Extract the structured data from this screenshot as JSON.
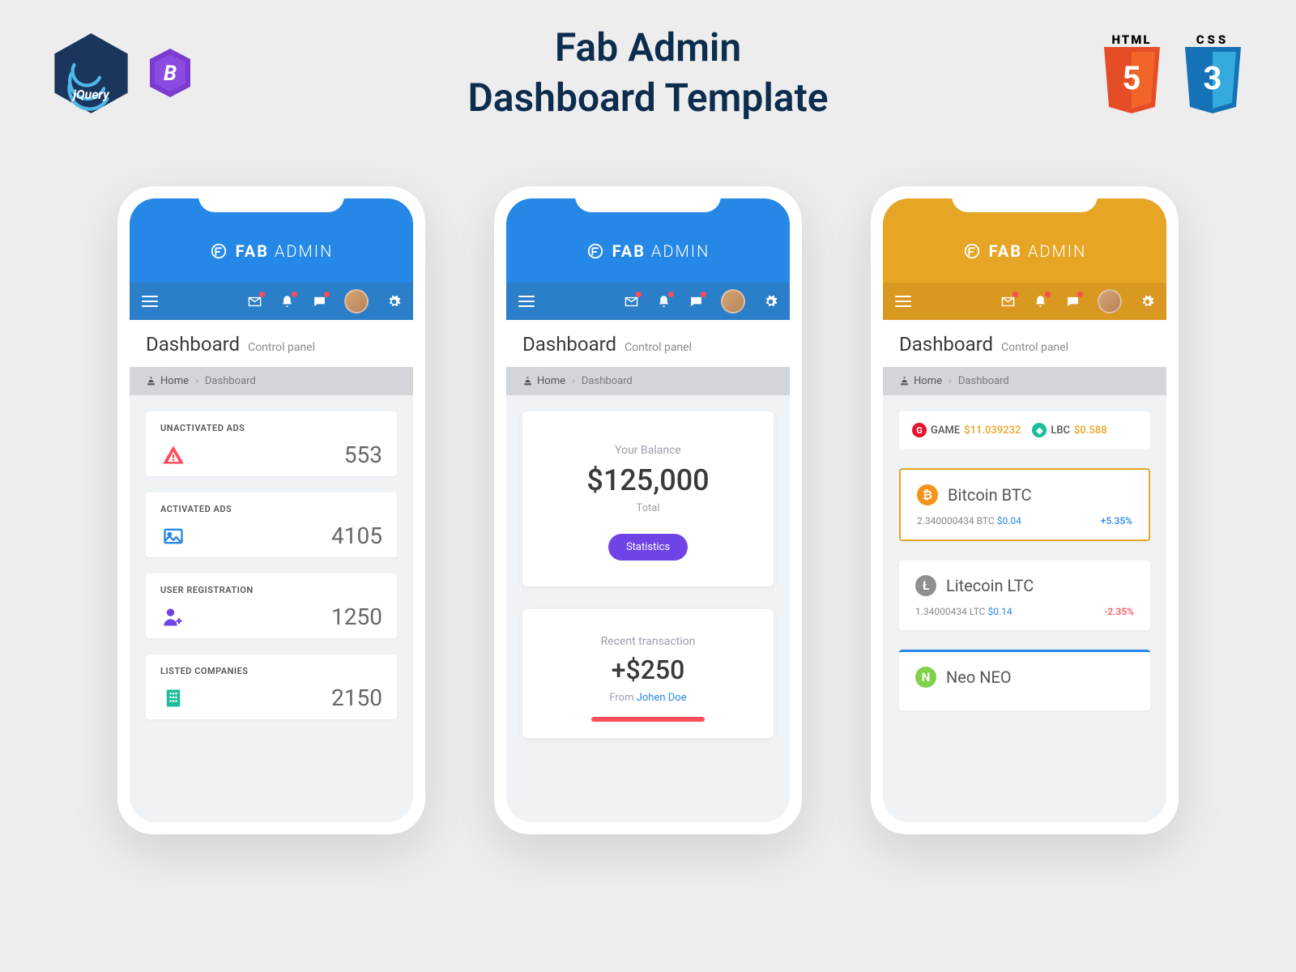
{
  "banner": {
    "title_line1": "Fab Admin",
    "title_line2": "Dashboard Template"
  },
  "brand": {
    "name_bold": "FAB",
    "name_light": "ADMIN"
  },
  "page": {
    "title": "Dashboard",
    "subtitle": "Control panel"
  },
  "breadcrumb": {
    "home": "Home",
    "current": "Dashboard"
  },
  "phone1": {
    "stats": [
      {
        "label": "UNACTIVATED ADS",
        "value": "553",
        "color": "#ff4a5a",
        "icon": "warn"
      },
      {
        "label": "ACTIVATED ADS",
        "value": "4105",
        "color": "#2587e6",
        "icon": "image"
      },
      {
        "label": "USER REGISTRATION",
        "value": "1250",
        "color": "#6e44e6",
        "icon": "user"
      },
      {
        "label": "LISTED COMPANIES",
        "value": "2150",
        "color": "#1abc9c",
        "icon": "building"
      }
    ]
  },
  "phone2": {
    "balance": {
      "label": "Your Balance",
      "amount": "$125,000",
      "sub": "Total",
      "button": "Statistics"
    },
    "tx": {
      "label": "Recent transaction",
      "amount": "+$250",
      "from_prefix": "From ",
      "from_name": "Johen Doe"
    }
  },
  "phone3": {
    "ticker": [
      {
        "icon_bg": "#e8142e",
        "icon_txt": "G",
        "name": "GAME",
        "val": "$11.039232"
      },
      {
        "icon_bg": "#1abc9c",
        "icon_txt": "◈",
        "name": "LBC",
        "val": "$0.588"
      }
    ],
    "coins": [
      {
        "border": "y",
        "icon_bg": "#f7931a",
        "icon_txt": "₿",
        "name": "Bitcoin BTC",
        "amt": "2.340000434 BTC",
        "price": "$0.04",
        "chg": "+5.35%",
        "dir": "up"
      },
      {
        "border": "",
        "icon_bg": "#8f8f8f",
        "icon_txt": "Ł",
        "name": "Litecoin LTC",
        "amt": "1.34000434 LTC",
        "price": "$0.14",
        "chg": "-2.35%",
        "dir": "down"
      },
      {
        "border": "g",
        "icon_bg": "#7fd14a",
        "icon_txt": "N",
        "name": "Neo NEO",
        "amt": "",
        "price": "",
        "chg": "",
        "dir": ""
      }
    ]
  }
}
